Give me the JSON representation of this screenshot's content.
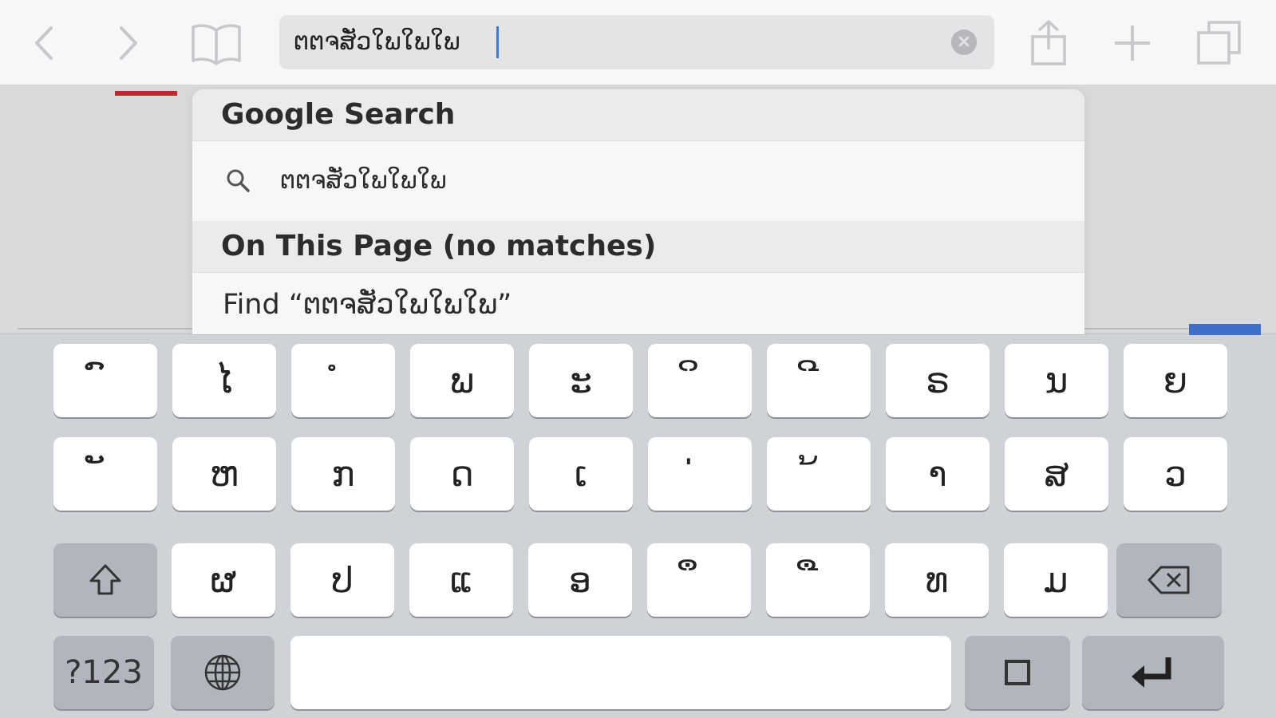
{
  "toolbar": {
    "back_icon": "chevron-left-icon",
    "forward_icon": "chevron-right-icon",
    "bookmarks_icon": "open-book-icon",
    "address_value": "ຕຕຈສັ່ວໃພໃພໃພ",
    "clear_icon": "clear-circle-icon",
    "share_icon": "share-icon",
    "new_tab_icon": "plus-icon",
    "tabs_icon": "tabs-icon"
  },
  "suggestions": {
    "google_header": "Google Search",
    "google_query": "ຕຕຈສັ່ວໃພໃພໃພ",
    "on_page_header": "On This Page (no matches)",
    "find_label": "Find “ຕຕຈສັ່ວໃພໃພໃພ”"
  },
  "keyboard": {
    "row1": [
      "ົ",
      "ໄ",
      "ໍ",
      "ພ",
      "ະ",
      "ິ",
      "ີ",
      "ຣ",
      "ນ",
      "ຍ"
    ],
    "row2": [
      "ັ",
      "ຫ",
      "ກ",
      "ດ",
      "ເ",
      "່",
      "້",
      "າ",
      "ສ",
      "ວ"
    ],
    "row3": [
      "ຜ",
      "ປ",
      "ແ",
      "ອ",
      "ຶ",
      "ື",
      "ທ",
      "ມ"
    ],
    "numbers_label": "?123",
    "globe_icon": "globe-icon",
    "shift_icon": "shift-icon",
    "delete_icon": "backspace-icon",
    "space_label": "",
    "keyboard_hide_icon": "square-icon",
    "return_icon": "return-icon"
  },
  "colors": {
    "caret": "#3a7bd5",
    "page_red_accent": "#c3272b",
    "page_blue_accent": "#3f6fc8"
  }
}
